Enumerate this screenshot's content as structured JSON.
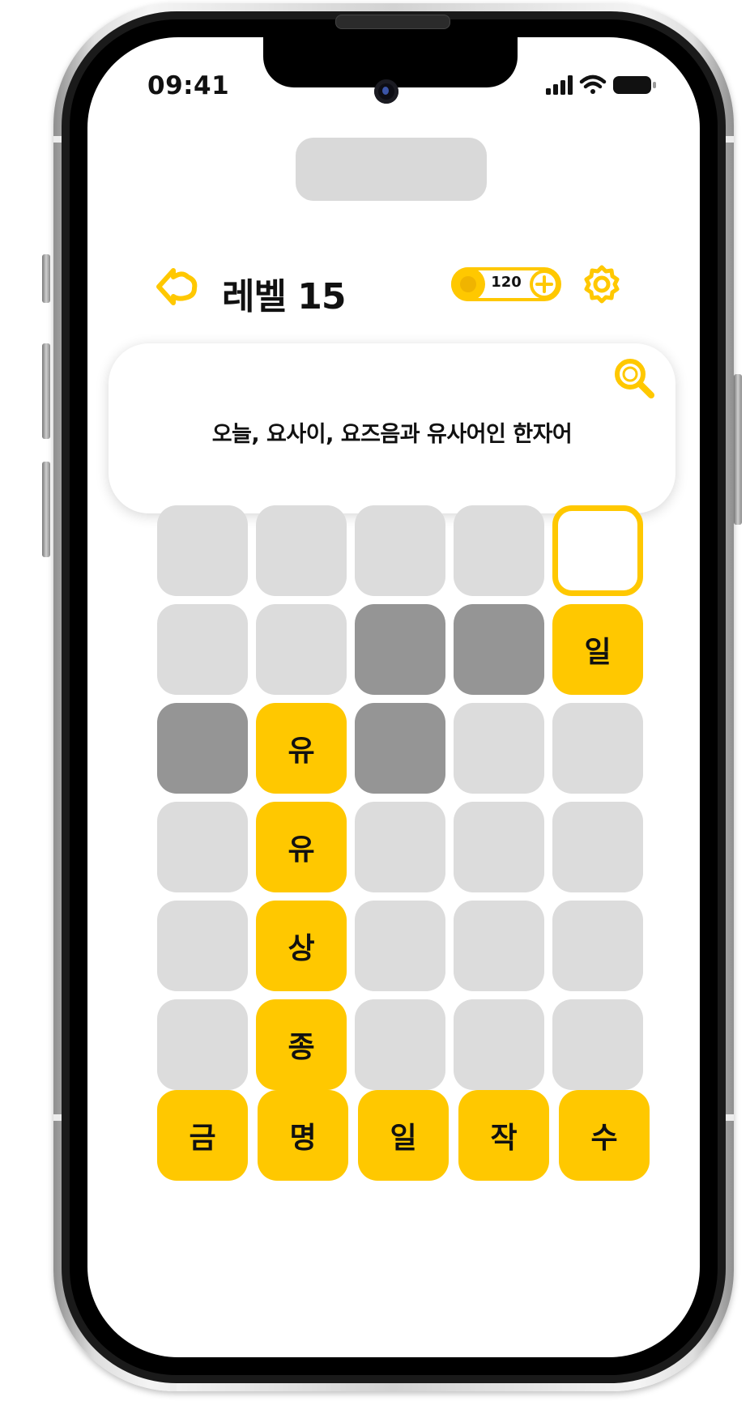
{
  "status_bar": {
    "time": "09:41"
  },
  "header": {
    "level_title": "레벨 15",
    "coins": "120"
  },
  "clue": {
    "text": "오늘, 요사이, 요즈음과 유사어인 한자어"
  },
  "grid": {
    "rows": [
      [
        {
          "state": "empty",
          "letter": ""
        },
        {
          "state": "empty",
          "letter": ""
        },
        {
          "state": "empty",
          "letter": ""
        },
        {
          "state": "empty",
          "letter": ""
        },
        {
          "state": "selected",
          "letter": ""
        }
      ],
      [
        {
          "state": "empty",
          "letter": ""
        },
        {
          "state": "empty",
          "letter": ""
        },
        {
          "state": "blocked",
          "letter": ""
        },
        {
          "state": "blocked",
          "letter": ""
        },
        {
          "state": "filled",
          "letter": "일"
        }
      ],
      [
        {
          "state": "blocked",
          "letter": ""
        },
        {
          "state": "filled",
          "letter": "유"
        },
        {
          "state": "blocked",
          "letter": ""
        },
        {
          "state": "empty",
          "letter": ""
        },
        {
          "state": "empty",
          "letter": ""
        }
      ],
      [
        {
          "state": "empty",
          "letter": ""
        },
        {
          "state": "filled",
          "letter": "유"
        },
        {
          "state": "empty",
          "letter": ""
        },
        {
          "state": "empty",
          "letter": ""
        },
        {
          "state": "empty",
          "letter": ""
        }
      ],
      [
        {
          "state": "empty",
          "letter": ""
        },
        {
          "state": "filled",
          "letter": "상"
        },
        {
          "state": "empty",
          "letter": ""
        },
        {
          "state": "empty",
          "letter": ""
        },
        {
          "state": "empty",
          "letter": ""
        }
      ],
      [
        {
          "state": "empty",
          "letter": ""
        },
        {
          "state": "filled",
          "letter": "종"
        },
        {
          "state": "empty",
          "letter": ""
        },
        {
          "state": "empty",
          "letter": ""
        },
        {
          "state": "empty",
          "letter": ""
        }
      ]
    ]
  },
  "keyboard": {
    "letters": [
      "금",
      "명",
      "일",
      "작",
      "수"
    ]
  },
  "icons": {
    "back": "cloud-arrow-back-icon",
    "coin": "coin-icon",
    "add_coins": "plus-circle-icon",
    "settings": "gear-icon",
    "hint": "magnifier-icon",
    "signal": "cellular-signal-icon",
    "wifi": "wifi-icon",
    "battery": "battery-icon"
  },
  "colors": {
    "accent": "#ffc800",
    "cell_empty": "#dcdcdc",
    "cell_blocked": "#959595",
    "text": "#111111"
  }
}
